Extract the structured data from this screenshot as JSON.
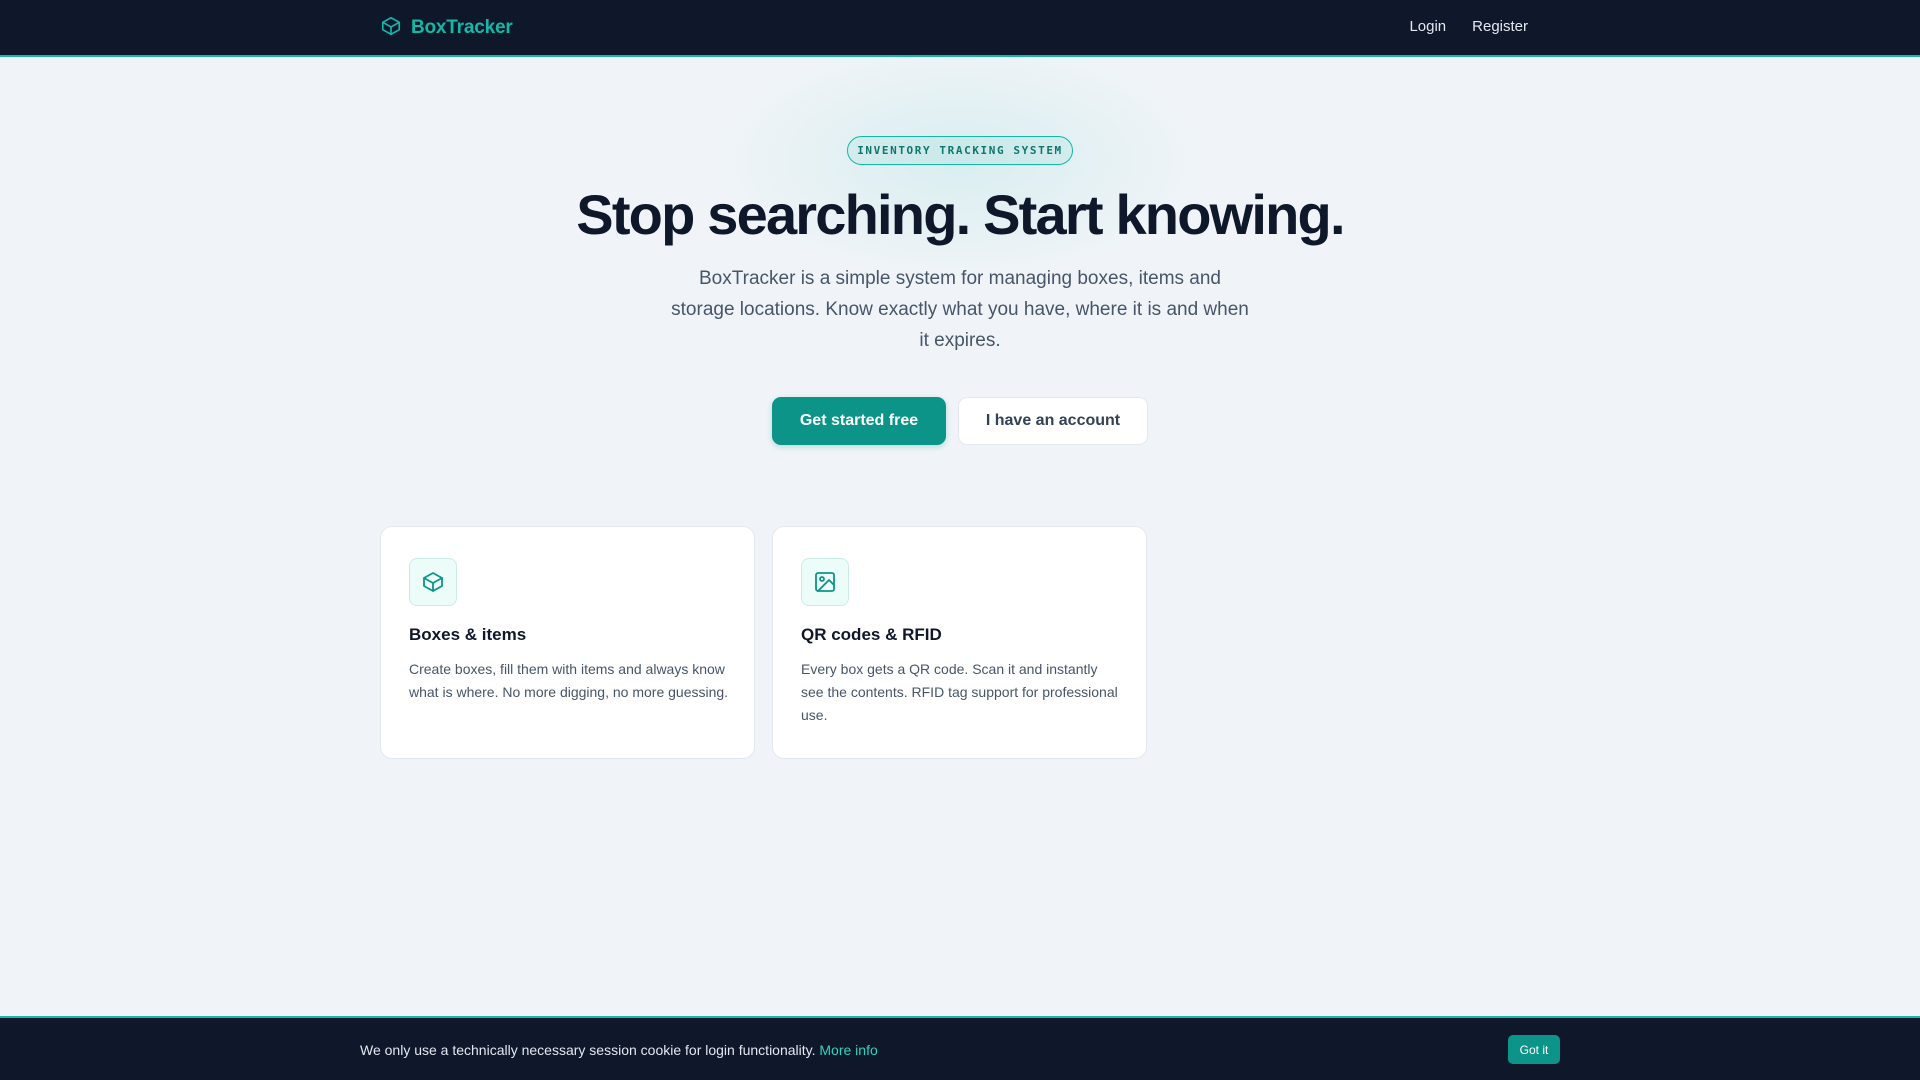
{
  "navbar": {
    "brand_name": "BoxTracker",
    "brand_icon": "box-icon",
    "links": [
      {
        "label": "Login"
      },
      {
        "label": "Register"
      }
    ]
  },
  "hero": {
    "badge": "INVENTORY TRACKING SYSTEM",
    "title": "Stop searching. Start knowing.",
    "subtitle": "BoxTracker is a simple system for managing boxes, items and storage locations. Know exactly what you have, where it is and when it expires.",
    "primary_cta": "Get started free",
    "secondary_cta": "I have an account"
  },
  "features": [
    {
      "icon": "box-icon",
      "title": "Boxes & items",
      "text": "Create boxes, fill them with items and always know what is where. No more digging, no more guessing."
    },
    {
      "icon": "image-icon",
      "title": "QR codes & RFID",
      "text": "Every box gets a QR code. Scan it and instantly see the contents. RFID tag support for professional use."
    }
  ],
  "cookie_banner": {
    "text": "We only use a technically necessary session cookie for login functionality.",
    "link_label": "More info",
    "button_label": "Got it"
  },
  "colors": {
    "nav_bg": "#0f172a",
    "accent": "#14b8a6",
    "primary_button": "#0d9488",
    "page_bg": "#f0f4f8"
  }
}
